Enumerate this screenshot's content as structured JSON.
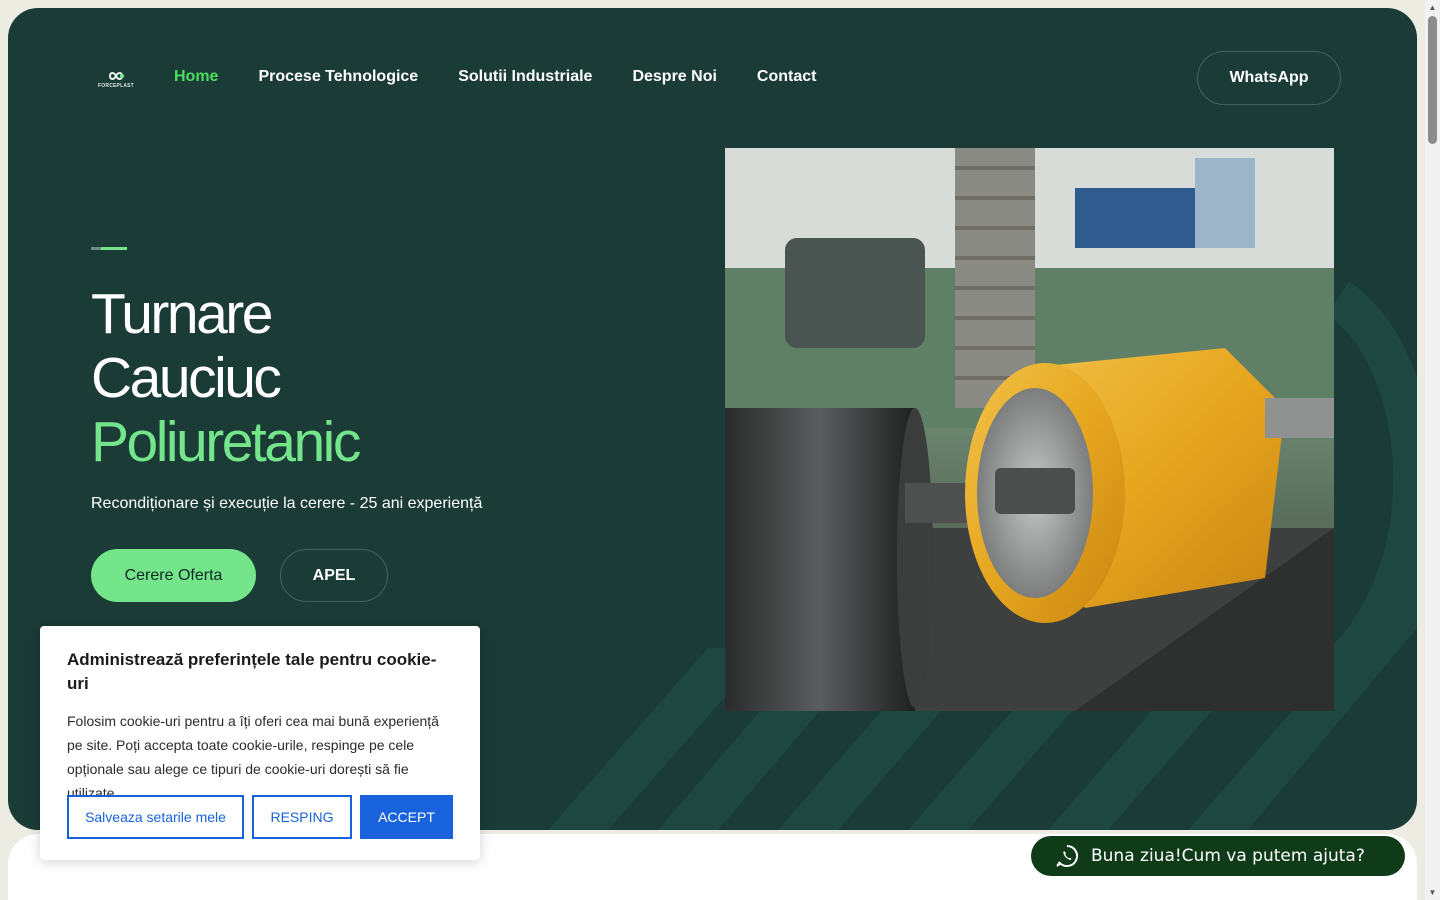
{
  "header": {
    "logo_text": "FORCEPLAST",
    "nav": [
      {
        "label": "Home",
        "active": true
      },
      {
        "label": "Procese Tehnologice",
        "active": false
      },
      {
        "label": "Solutii Industriale",
        "active": false
      },
      {
        "label": "Despre Noi",
        "active": false
      },
      {
        "label": "Contact",
        "active": false
      }
    ],
    "whatsapp_label": "WhatsApp"
  },
  "hero": {
    "title_line1": "Turnare",
    "title_line2": "Cauciuc",
    "title_highlight": "Poliuretanic",
    "subtitle": "Recondiționare și execuție la cerere - 25 ani experiență",
    "cta_primary": "Cerere Oferta",
    "cta_secondary": "APEL",
    "photo_icon": "polyurethane-roller-photo"
  },
  "cookie_banner": {
    "title": "Administrează preferințele tale pentru cookie-uri",
    "text": "Folosim cookie-uri pentru a îți oferi cea mai bună experiență pe site. Poți accepta toate cookie-urile, respinge pe cele opționale sau alege ce tipuri de cookie-uri dorești să fie utilizate.",
    "btn_save": "Salveaza setarile mele",
    "btn_reject": "RESPING",
    "btn_accept": "ACCEPT"
  },
  "chat": {
    "label": "Buna ziua!Cum va putem ajuta?",
    "icon": "whatsapp-icon"
  },
  "colors": {
    "hero_bg": "#1a3b36",
    "accent_green": "#74e58a",
    "nav_active": "#4ade60",
    "cookie_blue": "#1863dc",
    "chat_bg": "#0f3b19"
  }
}
